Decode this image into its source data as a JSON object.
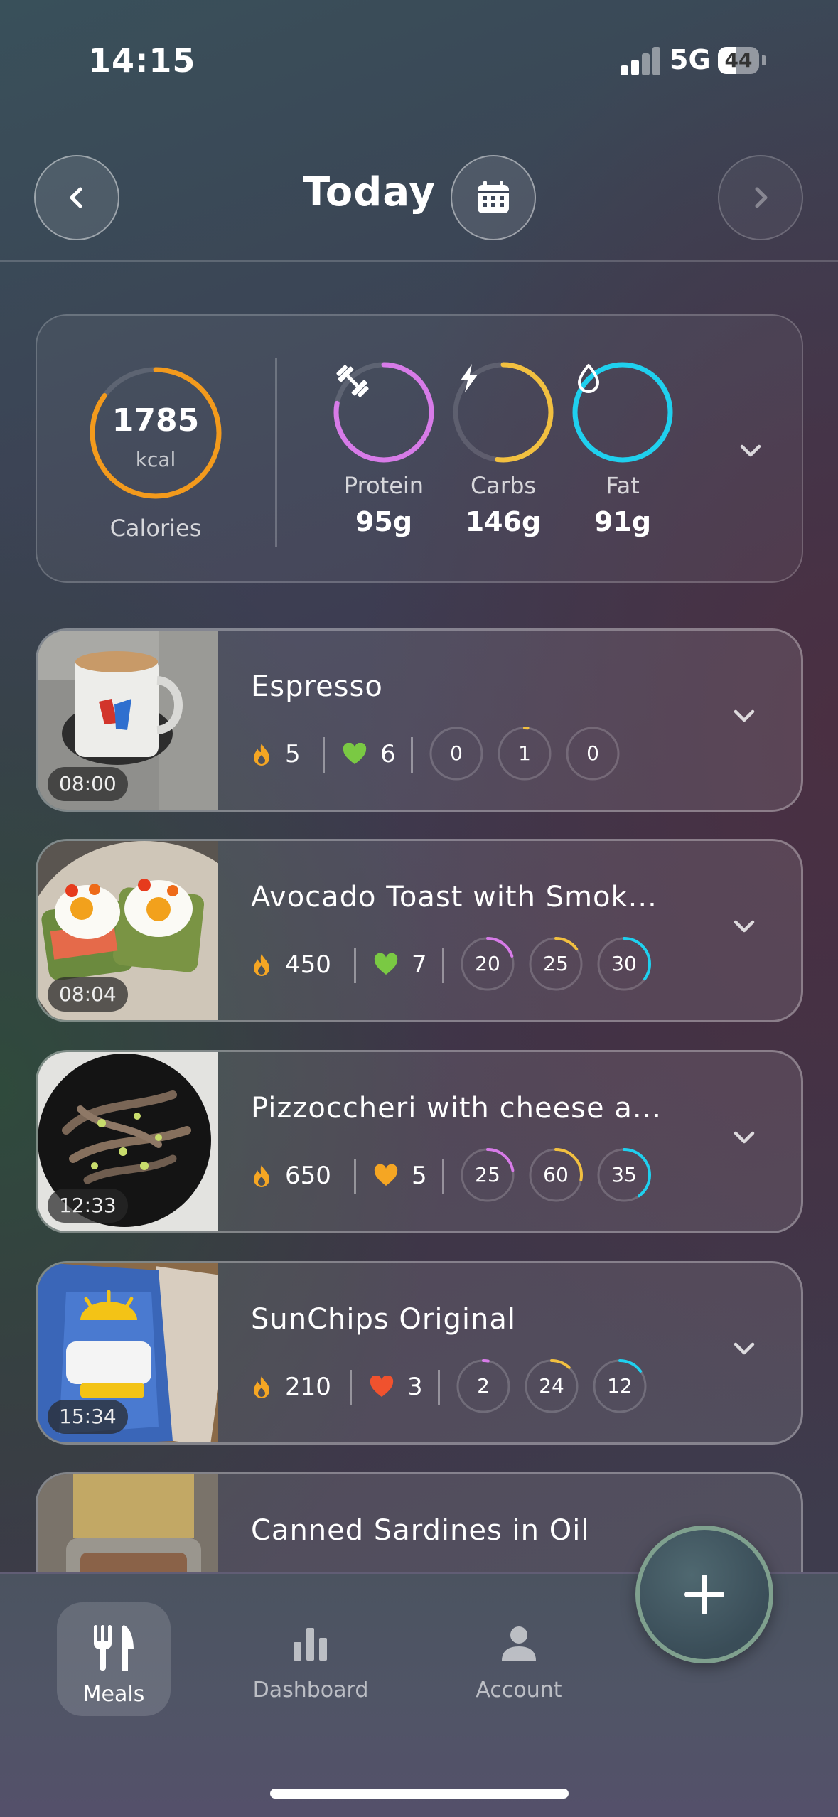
{
  "status": {
    "time": "14:15",
    "network": "5G",
    "battery": "44",
    "battery_level": 0.44
  },
  "header": {
    "title": "Today"
  },
  "summary": {
    "calories": {
      "value": "1785",
      "unit": "kcal",
      "label": "Calories",
      "progress": 0.85
    },
    "macros": [
      {
        "name": "Protein",
        "value": "95g",
        "progress": 0.78,
        "color": "#d77be8",
        "icon": "dumbbell-icon"
      },
      {
        "name": "Carbs",
        "value": "146g",
        "progress": 0.52,
        "color": "#f2c040",
        "icon": "lightning-icon"
      },
      {
        "name": "Fat",
        "value": "91g",
        "progress": 1.0,
        "color": "#1fd0ee",
        "icon": "droplet-icon"
      }
    ]
  },
  "meals": [
    {
      "time": "08:00",
      "title": "Espresso",
      "calories": "5",
      "score": "6",
      "score_color": "#7ac943",
      "protein": "0",
      "carbs": "1",
      "fat": "0",
      "p": 0.0,
      "c": 0.02,
      "f": 0.0
    },
    {
      "time": "08:04",
      "title": "Avocado Toast with Smok...",
      "calories": "450",
      "score": "7",
      "score_color": "#7ac943",
      "protein": "20",
      "carbs": "25",
      "fat": "30",
      "p": 0.2,
      "c": 0.15,
      "f": 0.35
    },
    {
      "time": "12:33",
      "title": "Pizzoccheri with cheese a...",
      "calories": "650",
      "score": "5",
      "score_color": "#f5a623",
      "protein": "25",
      "carbs": "60",
      "fat": "35",
      "p": 0.22,
      "c": 0.28,
      "f": 0.4
    },
    {
      "time": "15:34",
      "title": "SunChips Original",
      "calories": "210",
      "score": "3",
      "score_color": "#f0522e",
      "protein": "2",
      "carbs": "24",
      "fat": "12",
      "p": 0.03,
      "c": 0.12,
      "f": 0.15
    },
    {
      "time": "",
      "title": "Canned Sardines in Oil"
    }
  ],
  "tabs": [
    {
      "label": "Meals",
      "icon": "fork-knife-icon"
    },
    {
      "label": "Dashboard",
      "icon": "bar-chart-icon"
    },
    {
      "label": "Account",
      "icon": "person-icon"
    }
  ],
  "colors": {
    "calories_ring": "#f39a1c",
    "flame": "#f5a623",
    "protein": "#d77be8",
    "carbs": "#f2c040",
    "fat": "#1fd0ee"
  }
}
